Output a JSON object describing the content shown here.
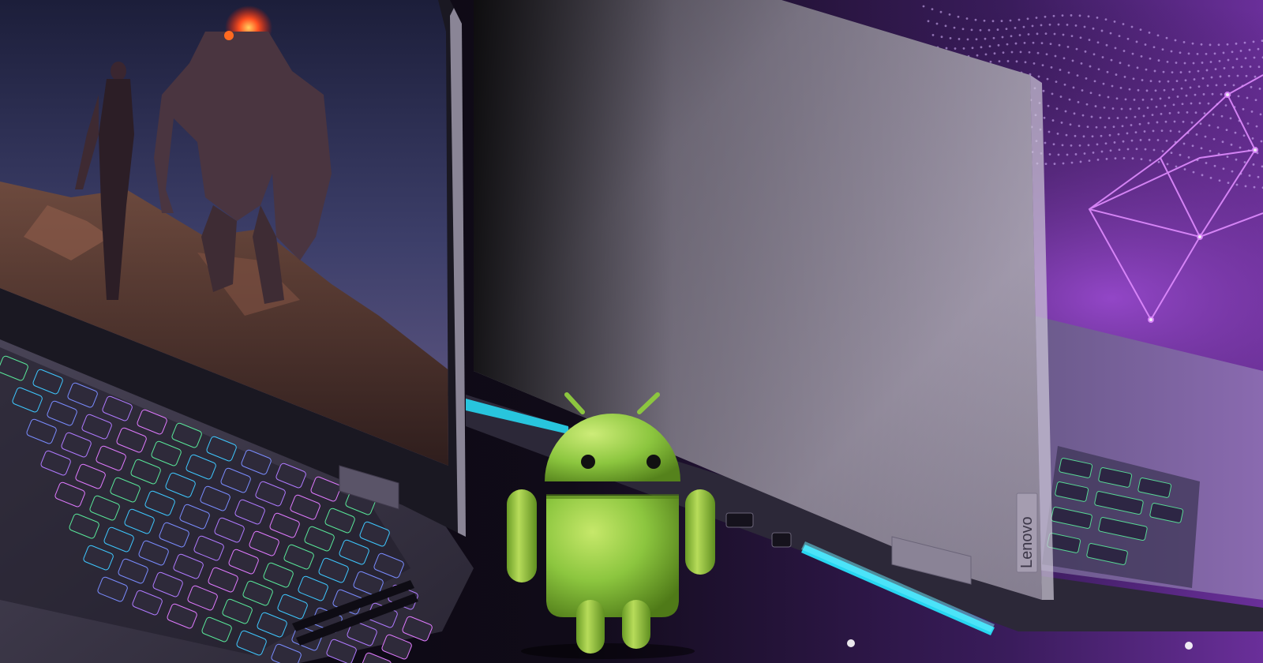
{
  "image": {
    "logo_text": "Lenovo",
    "colors": {
      "background_dark": "#0b0812",
      "purple_glow": "#7a3fb0",
      "laptop_lid": "#9a93a4",
      "laptop_frame": "#5c566a",
      "neon_cyan": "#28d6f0",
      "android_green": "#8cc63f",
      "android_shadow": "#5f8f20"
    }
  }
}
